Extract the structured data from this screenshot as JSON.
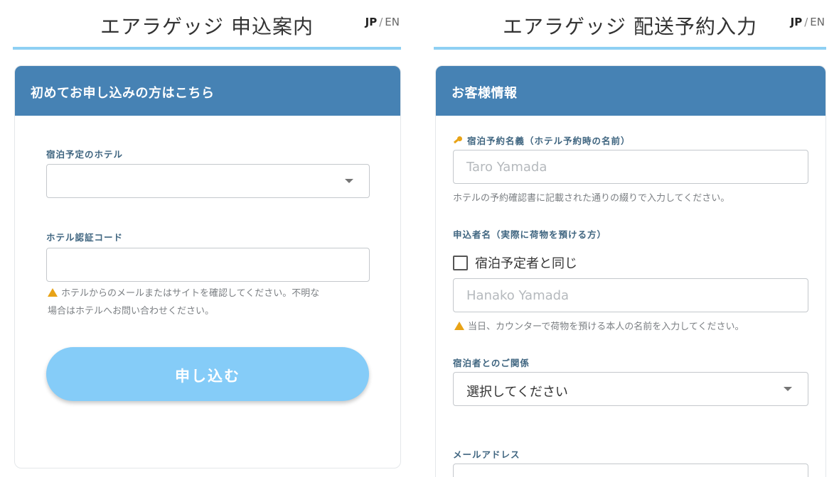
{
  "left": {
    "title": "エアラゲッジ 申込案内",
    "lang": {
      "jp": "JP",
      "sep": "/",
      "en": "EN"
    },
    "card_header": "初めてお申し込みの方はこちら",
    "hotel_label": "宿泊予定のホテル",
    "hotel_value": "",
    "auth_label": "ホテル認証コード",
    "auth_value": "",
    "auth_hint_line1": "ホテルからのメールまたはサイトを確認してください。不明な",
    "auth_hint_line2": "場合はホテルへお問い合わせください。",
    "submit_label": "申し込む"
  },
  "right": {
    "title": "エアラゲッジ 配送予約入力",
    "lang": {
      "jp": "JP",
      "sep": "/",
      "en": "EN"
    },
    "card_header": "お客様情報",
    "reservation_name_label": "宿泊予約名義（ホテル予約時の名前）",
    "reservation_name_placeholder": "Taro Yamada",
    "reservation_name_hint": "ホテルの予約確認書に記載された通りの綴りで入力してください。",
    "applicant_label": "申込者名（実際に荷物を預ける方）",
    "same_as_guest_label": "宿泊予定者と同じ",
    "applicant_placeholder": "Hanako Yamada",
    "applicant_hint": "当日、カウンターで荷物を預ける本人の名前を入力してください。",
    "relation_label": "宿泊者とのご関係",
    "relation_value": "選択してください",
    "email_label": "メールアドレス"
  },
  "colors": {
    "accent_line": "#8fd0f3",
    "card_header_bg": "#4682b4",
    "submit_bg": "#85ccf8",
    "warning": "#e8a317"
  },
  "icons": [
    "warning-icon",
    "key-icon",
    "chevron-down-icon",
    "checkbox-icon"
  ]
}
